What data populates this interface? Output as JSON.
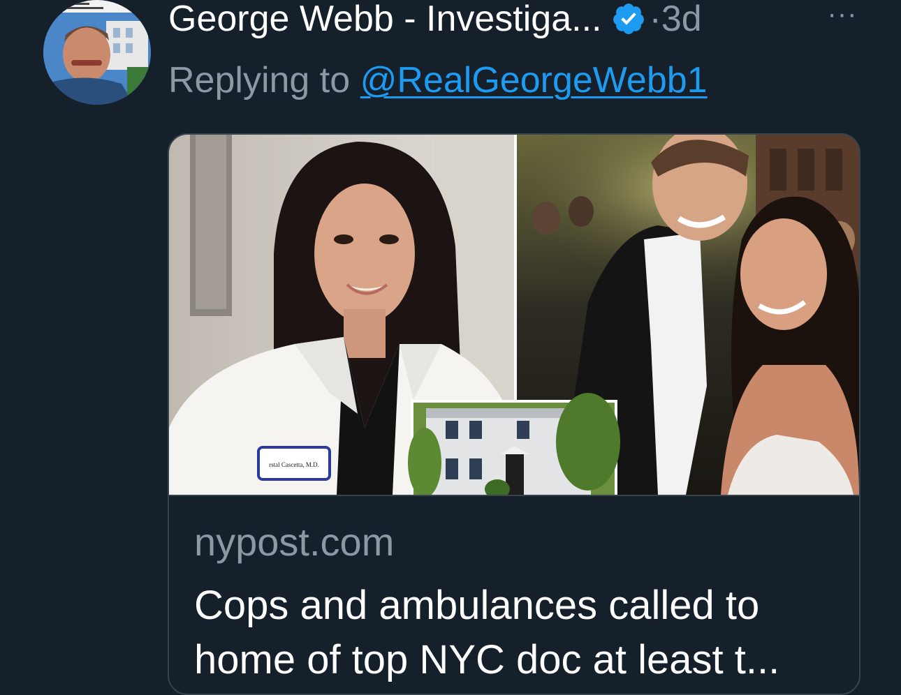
{
  "tweet": {
    "author_name": "George Webb - Investiga...",
    "separator": "·",
    "timestamp": "3d",
    "more_label": "···",
    "replying_label": "Replying to ",
    "replying_handle": "@RealGeorgeWebb1",
    "avatar_icon": "profile-photo",
    "verified_icon": "verified-badge-icon",
    "verified_color": "#1d9bf0"
  },
  "card": {
    "domain": "nypost.com",
    "headline": "Cops and ambulances called to home of top NYC doc at least t...",
    "badge_text": "rstal Cascetta, M.D."
  },
  "colors": {
    "background": "#15202b",
    "primary_text": "#ffffff",
    "secondary_text": "#8b98a5",
    "link": "#1d9bf0",
    "border": "#38444d"
  }
}
